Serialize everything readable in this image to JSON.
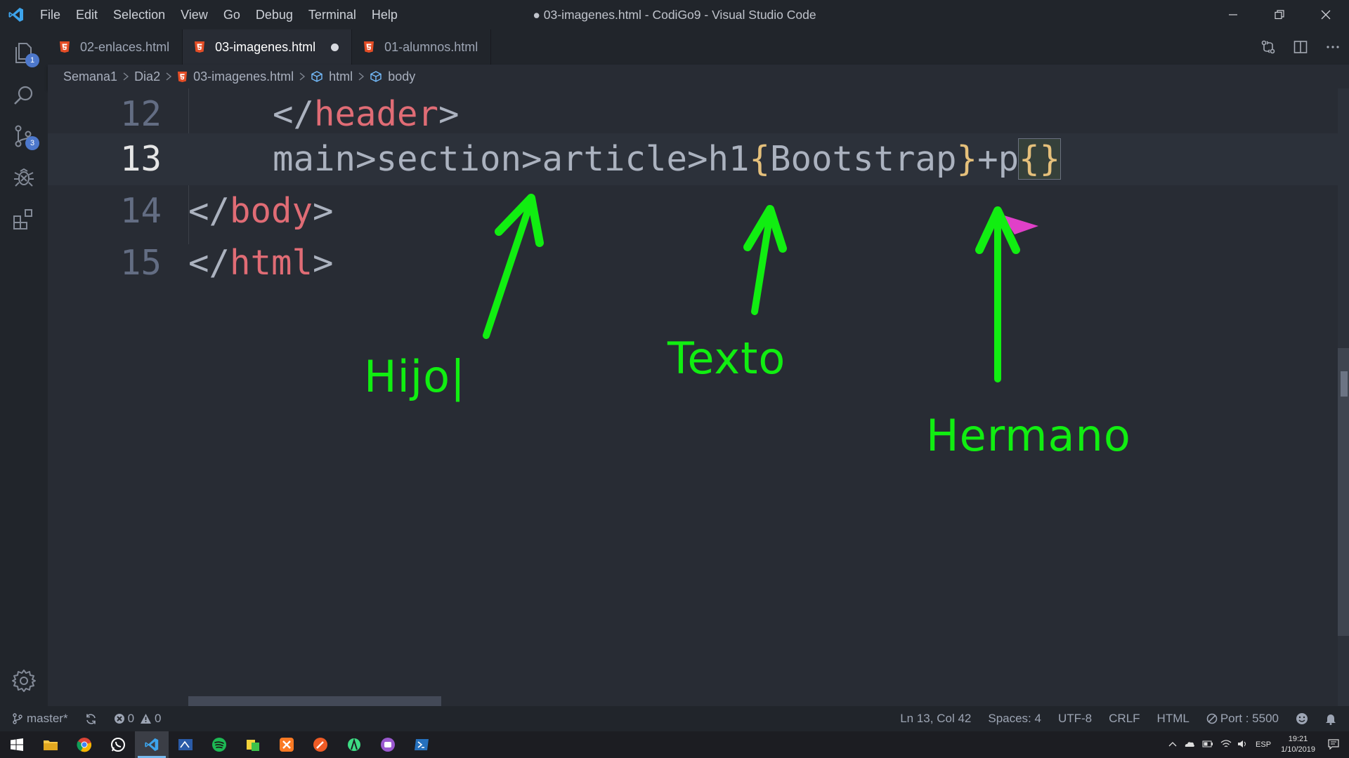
{
  "window": {
    "title": "● 03-imagenes.html - CodiGo9 - Visual Studio Code",
    "menu": [
      "File",
      "Edit",
      "Selection",
      "View",
      "Go",
      "Debug",
      "Terminal",
      "Help"
    ]
  },
  "activity_bar": {
    "items": [
      {
        "icon": "files-icon",
        "badge": "1"
      },
      {
        "icon": "search-icon",
        "badge": ""
      },
      {
        "icon": "source-control-icon",
        "badge": "3"
      },
      {
        "icon": "debug-icon",
        "badge": ""
      },
      {
        "icon": "extensions-icon",
        "badge": ""
      }
    ],
    "settings_icon": "gear-icon"
  },
  "tabs": [
    {
      "label": "02-enlaces.html",
      "active": false,
      "dirty": false
    },
    {
      "label": "03-imagenes.html",
      "active": true,
      "dirty": true
    },
    {
      "label": "01-alumnos.html",
      "active": false,
      "dirty": false
    }
  ],
  "breadcrumb": [
    "Semana1",
    "Dia2",
    "03-imagenes.html",
    "html",
    "body"
  ],
  "editor": {
    "lines": [
      {
        "number": "12",
        "text": "</header>"
      },
      {
        "number": "13",
        "text": "main>section>article>h1{Bootstrap}+p{}"
      },
      {
        "number": "14",
        "text": "</body>"
      },
      {
        "number": "15",
        "text": "</html>"
      }
    ],
    "current_line": "13"
  },
  "annotations": {
    "hijo": "Hijo|",
    "texto": "Texto",
    "hermano": "Hermano",
    "arrow_color": "#11ee11"
  },
  "status_bar": {
    "branch": "master*",
    "errors": "0",
    "warnings": "0",
    "position": "Ln 13, Col 42",
    "spaces": "Spaces: 4",
    "encoding": "UTF-8",
    "eol": "CRLF",
    "language": "HTML",
    "port": "Port : 5500"
  },
  "taskbar": {
    "time": "19:21",
    "date": "1/10/2019",
    "lang": "ESP"
  },
  "colors": {
    "editor_bg": "#282c34",
    "sidebar_bg": "#21252b",
    "tag": "#e06c75",
    "bracket": "#e5c07b",
    "html5_icon": "#e44d26"
  }
}
